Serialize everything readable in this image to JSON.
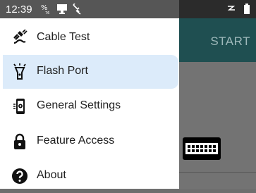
{
  "status_bar": {
    "time": "12:39",
    "icons": [
      "data-usage-icon",
      "cast-icon",
      "plugin-icon",
      "signal-icon",
      "battery-icon"
    ]
  },
  "background_app": {
    "action_label": "START",
    "header_color": "#1f4f51"
  },
  "drawer": {
    "selected_index": 1,
    "items": [
      {
        "label": "Cable Test",
        "icon": "cable-icon"
      },
      {
        "label": "Flash Port",
        "icon": "flashlight-icon"
      },
      {
        "label": "General Settings",
        "icon": "phone-settings-icon"
      },
      {
        "label": "Feature Access",
        "icon": "lock-icon"
      },
      {
        "label": "About",
        "icon": "help-icon"
      }
    ],
    "selected_color": "#dcebfa"
  }
}
